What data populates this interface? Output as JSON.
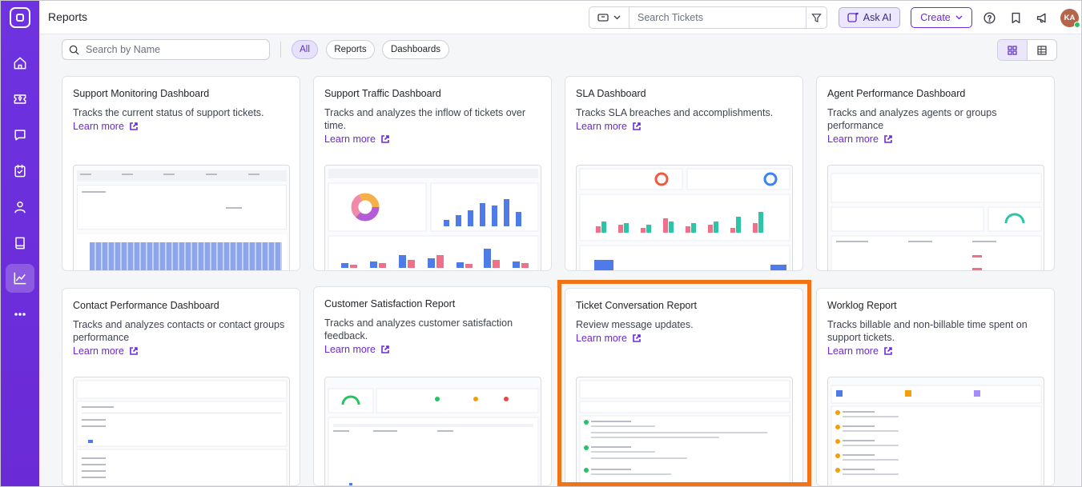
{
  "app": {
    "page_title": "Reports"
  },
  "header": {
    "ticket_search_placeholder": "Search Tickets",
    "ask_ai_label": "Ask AI",
    "create_label": "Create",
    "avatar_initials": "KA"
  },
  "toolbar": {
    "name_search_placeholder": "Search by Name",
    "chips": [
      "All",
      "Reports",
      "Dashboards"
    ],
    "active_chip": "All",
    "view_mode": "grid"
  },
  "cards": [
    {
      "title": "Support Monitoring Dashboard",
      "description": "Tracks the current status of support tickets.",
      "learn_more": "Learn more"
    },
    {
      "title": "Support Traffic Dashboard",
      "description": "Tracks and analyzes the inflow of tickets over time.",
      "learn_more": "Learn more"
    },
    {
      "title": "SLA Dashboard",
      "description": "Tracks SLA breaches and accomplishments.",
      "learn_more": "Learn more"
    },
    {
      "title": "Agent Performance Dashboard",
      "description": "Tracks and analyzes agents or groups performance",
      "learn_more": "Learn more"
    },
    {
      "title": "Contact Performance Dashboard",
      "description": "Tracks and analyzes contacts or contact groups performance",
      "learn_more": "Learn more"
    },
    {
      "title": "Customer Satisfaction Report",
      "description": "Tracks and analyzes customer satisfaction feedback.",
      "learn_more": "Learn more"
    },
    {
      "title": "Ticket Conversation Report",
      "description": "Review message updates.",
      "learn_more": "Learn more"
    },
    {
      "title": "Worklog Report",
      "description": "Tracks billable and non-billable time spent on support tickets.",
      "learn_more": "Learn more"
    }
  ],
  "colors": {
    "brand": "#6d28d9",
    "highlight": "#f47216",
    "bar_blue": "#4f7be8",
    "bar_pink": "#f0708a",
    "bar_teal": "#2dc5a8"
  }
}
